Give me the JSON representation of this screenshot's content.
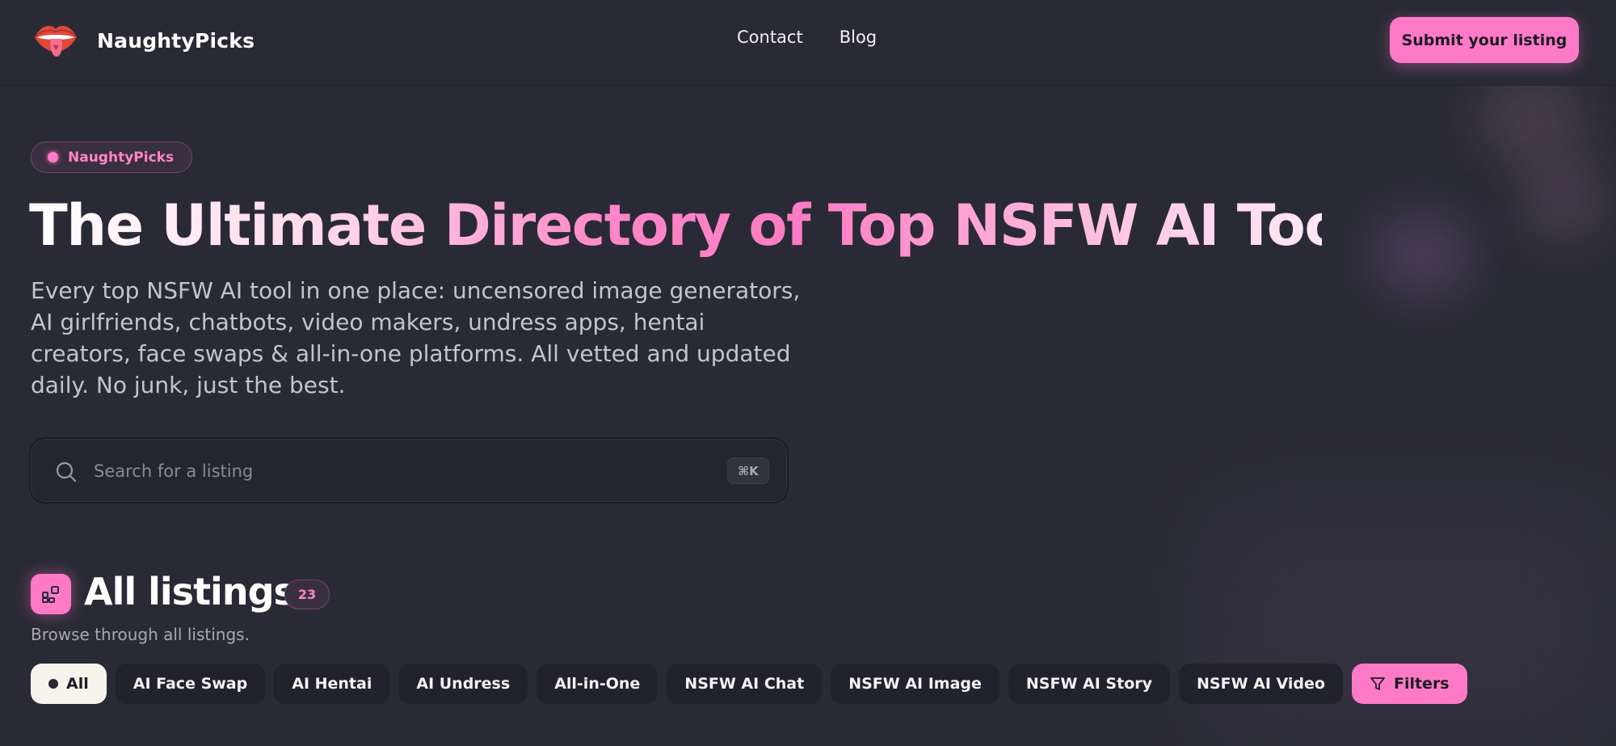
{
  "header": {
    "brand": "NaughtyPicks",
    "nav": [
      "Contact",
      "Blog"
    ],
    "submit_label": "Submit your listing"
  },
  "hero": {
    "badge": "NaughtyPicks",
    "title": "The Ultimate Directory of Top NSFW AI Tools",
    "subtitle": "Every top NSFW AI tool in one place: uncensored image generators, AI girlfriends, chatbots, video makers, undress apps, hentai creators, face swaps & all-in-one platforms. All vetted and updated daily. No junk, just the best."
  },
  "search": {
    "placeholder": "Search for a listing",
    "value": "",
    "shortcut": "⌘K"
  },
  "listings": {
    "title": "All listings",
    "count": "23",
    "subtitle": "Browse through all listings.",
    "categories": [
      "All",
      "AI Face Swap",
      "AI Hentai",
      "AI Undress",
      "All-in-One",
      "NSFW AI Chat",
      "NSFW AI Image",
      "NSFW AI Story",
      "NSFW AI Video"
    ],
    "selected": "All",
    "filters_label": "Filters"
  },
  "colors": {
    "accent": "#ff7ac6",
    "background": "#2a2a36",
    "chip": "#22222c",
    "active_chip": "#f7f4ec"
  },
  "icons": {
    "logo": "lips-tongue-icon",
    "search": "search-icon",
    "listings": "grid-icon",
    "filters": "funnel-icon"
  }
}
